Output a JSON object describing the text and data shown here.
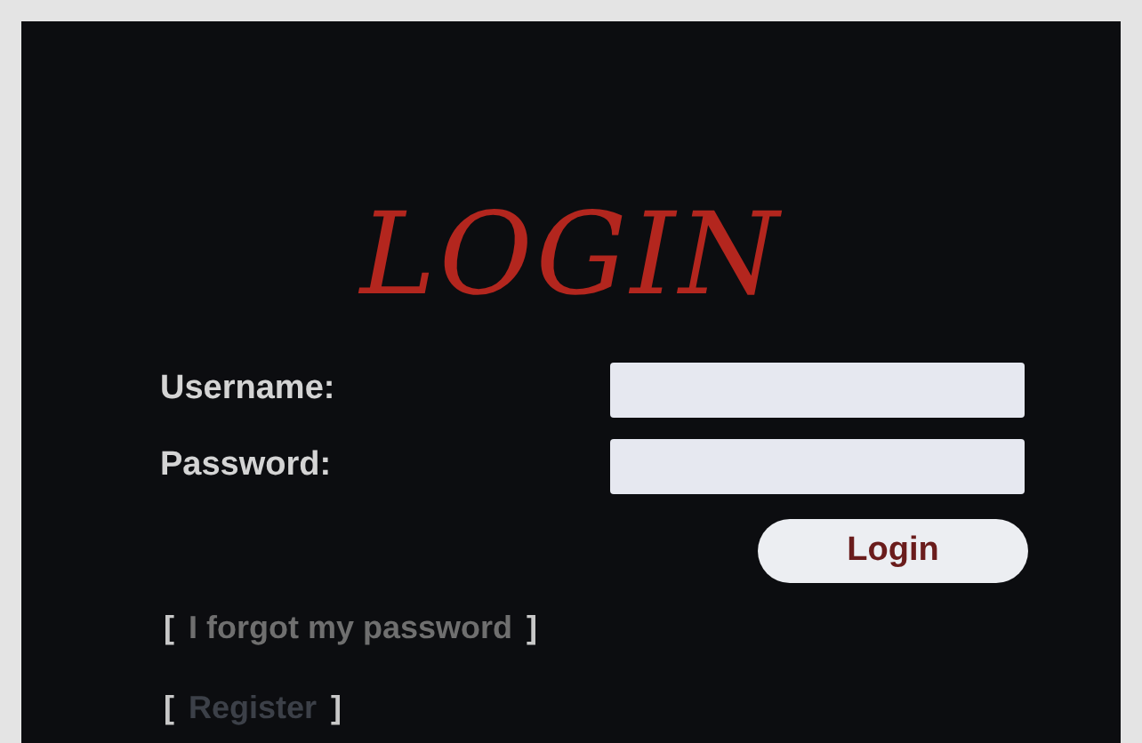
{
  "title": "LOGIN",
  "fields": [
    {
      "label": "Username:"
    },
    {
      "label": "Password:"
    }
  ],
  "button": "Login",
  "links": [
    {
      "open": "[",
      "text": "I forgot my password",
      "close": "]"
    },
    {
      "open": "[",
      "text": "Register",
      "close": "]"
    }
  ]
}
